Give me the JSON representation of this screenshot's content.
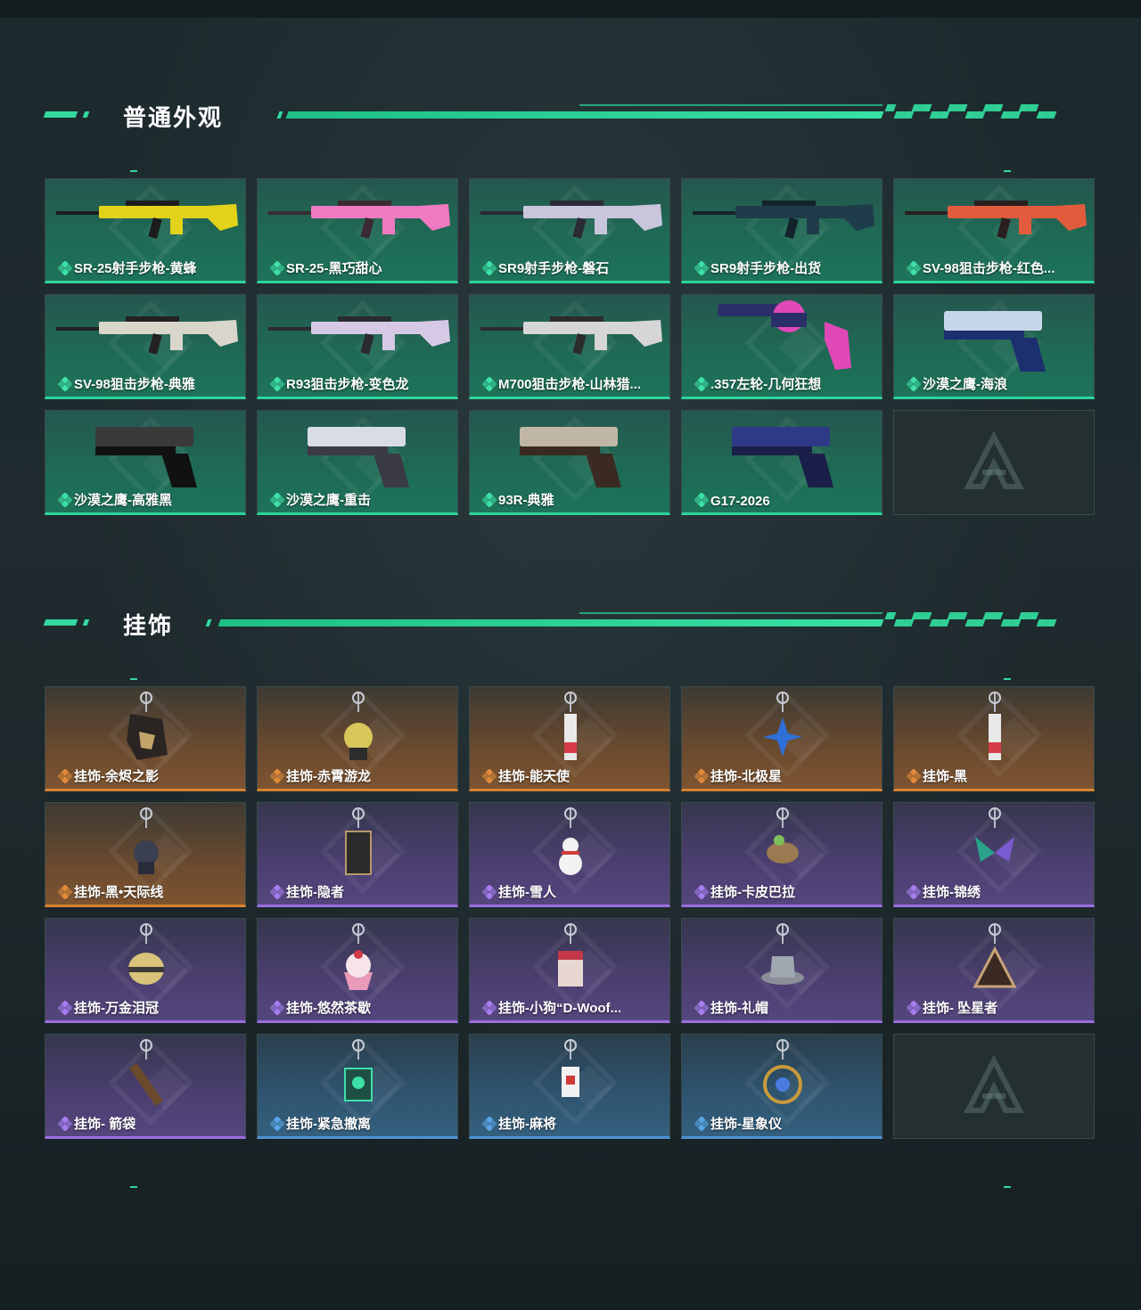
{
  "sections": [
    {
      "title": "普通外观",
      "items": [
        {
          "label": "SR-25射手步枪-黄蜂",
          "rarity": "green",
          "art": "rifle-yellow-icon"
        },
        {
          "label": "SR-25-黑巧甜心",
          "rarity": "green",
          "art": "rifle-pink-icon"
        },
        {
          "label": "SR9射手步枪-磐石",
          "rarity": "green",
          "art": "rifle-white-icon"
        },
        {
          "label": "SR9射手步枪-出货",
          "rarity": "green",
          "art": "rifle-dark-icon"
        },
        {
          "label": "SV-98狙击步枪-红色...",
          "rarity": "green",
          "art": "sniper-red-icon"
        },
        {
          "label": "SV-98狙击步枪-典雅",
          "rarity": "green",
          "art": "sniper-white-icon"
        },
        {
          "label": "R93狙击步枪-变色龙",
          "rarity": "green",
          "art": "sniper-camo-icon"
        },
        {
          "label": "M700狙击步枪-山林猎...",
          "rarity": "green",
          "art": "sniper-grey-icon"
        },
        {
          "label": ".357左轮-几何狂想",
          "rarity": "green",
          "art": "revolver-icon"
        },
        {
          "label": "沙漠之鹰-海浪",
          "rarity": "green",
          "art": "pistol-blue-icon"
        },
        {
          "label": "沙漠之鹰-高雅黑",
          "rarity": "green",
          "art": "pistol-black-icon"
        },
        {
          "label": "沙漠之鹰-重击",
          "rarity": "green",
          "art": "pistol-white-icon"
        },
        {
          "label": "93R-典雅",
          "rarity": "green",
          "art": "pistol-tan-icon"
        },
        {
          "label": "G17-2026",
          "rarity": "green",
          "art": "pistol-navy-icon"
        },
        {
          "label": "",
          "rarity": "empty",
          "art": "brand-logo-icon"
        }
      ]
    },
    {
      "title": "挂饰",
      "items": [
        {
          "label": "挂饰-余烬之影",
          "rarity": "orange",
          "art": "charm-figure-icon"
        },
        {
          "label": "挂饰-赤霄游龙",
          "rarity": "orange",
          "art": "charm-dragon-icon"
        },
        {
          "label": "挂饰-能天使",
          "rarity": "orange",
          "art": "charm-card-icon"
        },
        {
          "label": "挂饰-北极星",
          "rarity": "orange",
          "art": "charm-star-icon"
        },
        {
          "label": "挂饰-黑",
          "rarity": "orange",
          "art": "charm-card-icon"
        },
        {
          "label": "挂饰-黑•天际线",
          "rarity": "orange",
          "art": "charm-doll-icon"
        },
        {
          "label": "挂饰-隐者",
          "rarity": "purple",
          "art": "charm-tarot-icon"
        },
        {
          "label": "挂饰-雪人",
          "rarity": "purple",
          "art": "charm-snowman-icon"
        },
        {
          "label": "挂饰-卡皮巴拉",
          "rarity": "purple",
          "art": "charm-capybara-icon"
        },
        {
          "label": "挂饰-锦绣",
          "rarity": "purple",
          "art": "charm-butterfly-icon"
        },
        {
          "label": "挂饰-万金泪冠",
          "rarity": "purple",
          "art": "charm-crown-icon"
        },
        {
          "label": "挂饰-悠然茶歇",
          "rarity": "purple",
          "art": "charm-cupcake-icon"
        },
        {
          "label": "挂饰-小狗“D-Woof...",
          "rarity": "purple",
          "art": "charm-dog-icon"
        },
        {
          "label": "挂饰-礼帽",
          "rarity": "purple",
          "art": "charm-hat-icon"
        },
        {
          "label": "挂饰- 坠星者",
          "rarity": "purple",
          "art": "charm-triangle-icon"
        },
        {
          "label": "挂饰- 箭袋",
          "rarity": "purple",
          "art": "charm-quiver-icon"
        },
        {
          "label": "挂饰-紧急撤离",
          "rarity": "blue",
          "art": "charm-badge-icon"
        },
        {
          "label": "挂饰-麻将",
          "rarity": "blue",
          "art": "charm-mahjong-icon"
        },
        {
          "label": "挂饰-星象仪",
          "rarity": "blue",
          "art": "charm-astrolabe-icon"
        },
        {
          "label": "",
          "rarity": "empty",
          "art": "brand-logo-icon"
        }
      ]
    }
  ],
  "colors": {
    "accent": "#33d9a0",
    "green": "#2ed39b",
    "orange": "#d9812f",
    "purple": "#9a6ee0",
    "blue": "#4e93d4"
  }
}
